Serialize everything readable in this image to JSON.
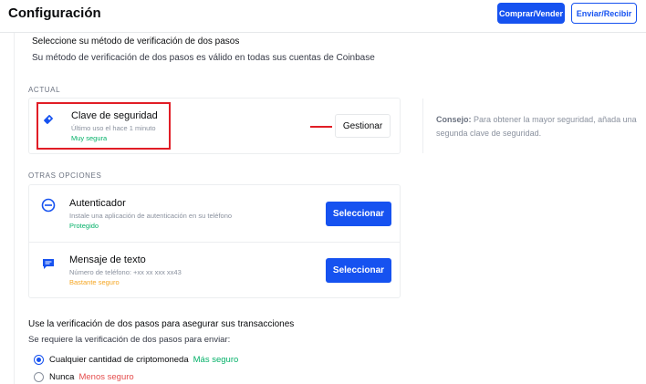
{
  "header": {
    "title": "Configuración",
    "buy_sell_label": "Comprar/Vender",
    "send_receive_label": "Enviar/Recibir"
  },
  "two_step": {
    "heading": "Seleccione su método de verificación de dos pasos",
    "subheading": "Su método de verificación de dos pasos es válido en todas sus cuentas de Coinbase"
  },
  "current": {
    "group_label": "ACTUAL",
    "method": {
      "title": "Clave de seguridad",
      "meta": "Último uso el hace 1 minuto",
      "status": "Muy segura",
      "icon": "security-key-icon",
      "manage_label": "Gestionar"
    }
  },
  "tip": {
    "label": "Consejo:",
    "text": "Para obtener la mayor seguridad, añada una segunda clave de seguridad."
  },
  "other_options": {
    "group_label": "OTRAS OPCIONES",
    "items": [
      {
        "title": "Autenticador",
        "meta": "Instale una aplicación de autenticación en su teléfono",
        "status": "Protegido",
        "icon": "authenticator-icon",
        "action_label": "Seleccionar"
      },
      {
        "title": "Mensaje de texto",
        "meta": "Número de teléfono: +xx xx xxx xx43",
        "status": "Bastante seguro",
        "icon": "sms-icon",
        "action_label": "Seleccionar"
      }
    ]
  },
  "transactions": {
    "heading": "Use la verificación de dos pasos para asegurar sus transacciones",
    "subheading": "Se requiere la verificación de dos pasos para enviar:",
    "options": [
      {
        "label": "Cualquier cantidad de criptomoneda",
        "note": "Más seguro",
        "selected": true
      },
      {
        "label": "Nunca",
        "note": "Menos seguro",
        "selected": false
      }
    ]
  },
  "colors": {
    "accent": "#1652f0",
    "green": "#05b169",
    "orange": "#f5a623",
    "red_note": "#e54d4d",
    "highlight": "#e11d26"
  }
}
